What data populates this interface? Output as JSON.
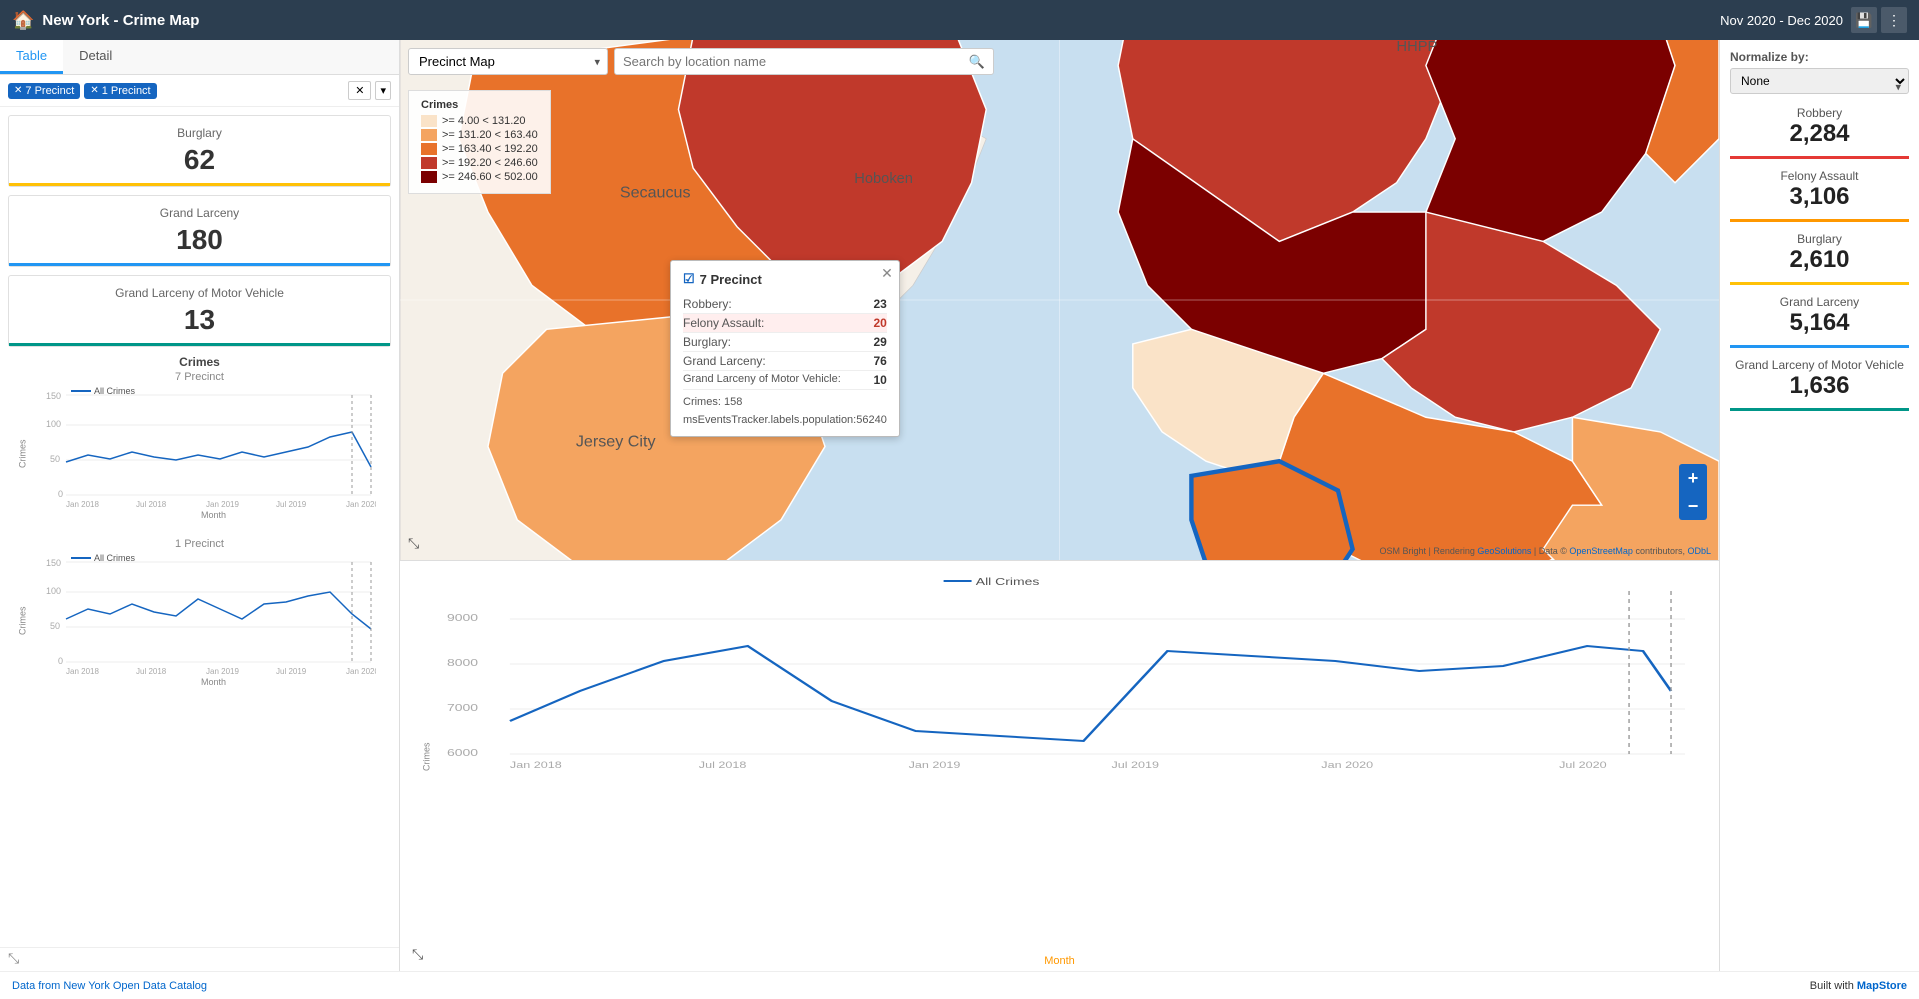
{
  "header": {
    "title": "New York - Crime Map",
    "date_range": "Nov 2020 - Dec 2020",
    "home_icon": "🏠"
  },
  "tabs": {
    "table_label": "Table",
    "detail_label": "Detail"
  },
  "filters": {
    "tag1": "7 Precinct",
    "tag2": "1 Precinct"
  },
  "stat_cards": {
    "burglary_label": "Burglary",
    "burglary_value": "62",
    "grand_larceny_label": "Grand Larceny",
    "grand_larceny_value": "180",
    "grand_larceny_mv_label": "Grand Larceny of Motor Vehicle",
    "grand_larceny_mv_value": "13"
  },
  "charts_left": {
    "crimes_title": "Crimes",
    "chart1_subtitle": "7 Precinct",
    "chart1_legend": "All Crimes",
    "chart2_subtitle": "1 Precinct",
    "chart2_legend": "All Crimes",
    "y_label": "Crimes",
    "x_label": "Month"
  },
  "map": {
    "dropdown_label": "Precinct Map",
    "search_placeholder": "Search by location name",
    "legend_title": "Crimes",
    "legend_items": [
      {
        "range": ">= 4.00 < 131.20",
        "color": "#FAE3C8"
      },
      {
        "range": ">= 131.20 < 163.40",
        "color": "#F4A460"
      },
      {
        "range": ">= 163.40 < 192.20",
        "color": "#E8722A"
      },
      {
        "range": ">= 192.20 < 246.60",
        "color": "#C0392B"
      },
      {
        "range": ">= 246.60 < 502.00",
        "color": "#7B0000"
      }
    ],
    "popup": {
      "title": "7 Precinct",
      "robbery_label": "Robbery:",
      "robbery_val": "23",
      "felony_label": "Felony Assault:",
      "felony_val": "20",
      "burglary_label": "Burglary:",
      "burglary_val": "29",
      "grand_larceny_label": "Grand Larceny:",
      "grand_larceny_val": "76",
      "glmv_label": "Grand Larceny of Motor Vehicle:",
      "glmv_val": "10",
      "crimes_label": "Crimes:",
      "crimes_val": "158",
      "population_label": "msEventsTracker.labels.population:56240"
    },
    "attribution": "OSM Bright | Rendering GeoSolutions | Data © OpenStreetMap contributors, ODbL"
  },
  "bottom_chart": {
    "legend": "All Crimes",
    "y_label": "Crimes",
    "x_label": "Month",
    "y_ticks": [
      "6000",
      "7000",
      "8000",
      "9000"
    ]
  },
  "right_panel": {
    "normalize_label": "Normalize by:",
    "normalize_value": "None",
    "robbery_label": "Robbery",
    "robbery_val": "2,284",
    "felony_label": "Felony Assault",
    "felony_val": "3,106",
    "burglary_label": "Burglary",
    "burglary_val": "2,610",
    "grand_larceny_label": "Grand Larceny",
    "grand_larceny_val": "5,164",
    "glmv_label": "Grand Larceny of Motor Vehicle",
    "glmv_val": "1,636"
  },
  "footer": {
    "left_text": "Data from New York Open Data Catalog",
    "right_text": "Built with MapStore"
  }
}
